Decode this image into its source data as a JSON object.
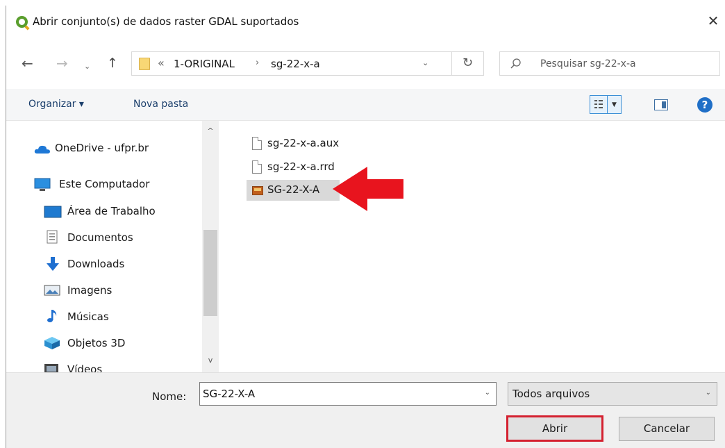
{
  "window": {
    "title": "Abrir conjunto(s) de dados raster GDAL suportados",
    "close_glyph": "✕"
  },
  "nav": {
    "back": "←",
    "forward": "→",
    "recent": "⌄",
    "up": "↑",
    "refresh": "↻"
  },
  "address": {
    "chevron": "«",
    "crumbs": [
      "1-ORIGINAL",
      "sg-22-x-a"
    ],
    "separator": "›",
    "dropdown": "⌄"
  },
  "search": {
    "placeholder": "Pesquisar sg-22-x-a",
    "value": ""
  },
  "toolbar": {
    "organize_label": "Organizar ▾",
    "new_folder_label": "Nova pasta",
    "view_dd": "▼",
    "help": "?"
  },
  "sidebar": {
    "items": [
      {
        "label": "OneDrive - ufpr.br",
        "icon": "cloud-icon"
      },
      {
        "label": "Este Computador",
        "icon": "computer-icon"
      },
      {
        "label": "Área de Trabalho",
        "icon": "desktop-icon"
      },
      {
        "label": "Documentos",
        "icon": "document-icon"
      },
      {
        "label": "Downloads",
        "icon": "download-icon"
      },
      {
        "label": "Imagens",
        "icon": "image-icon"
      },
      {
        "label": "Músicas",
        "icon": "music-icon"
      },
      {
        "label": "Objetos 3D",
        "icon": "cube-icon"
      },
      {
        "label": "Vídeos",
        "icon": "video-icon"
      }
    ],
    "scroll_up": "^",
    "scroll_down": "v"
  },
  "files": [
    {
      "name": "sg-22-x-a.aux",
      "icon": "file-icon",
      "selected": false
    },
    {
      "name": "sg-22-x-a.rrd",
      "icon": "file-icon",
      "selected": false
    },
    {
      "name": "SG-22-X-A",
      "icon": "raster-image-icon",
      "selected": true
    }
  ],
  "annotation": {
    "arrow_color": "#e8141e",
    "highlight_color": "#d42130"
  },
  "bottom": {
    "name_label": "Nome:",
    "name_value": "SG-22-X-A",
    "filter_value": "Todos arquivos",
    "dropdown": "⌄",
    "open_label": "Abrir",
    "cancel_label": "Cancelar"
  }
}
